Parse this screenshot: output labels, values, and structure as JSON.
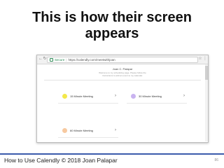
{
  "slide": {
    "title_line1": "This is how their screen",
    "title_line2": "appears",
    "footer": "How to Use Calendly © 2018 Joan Palapar",
    "page_number": "86"
  },
  "browser": {
    "secure_label": "Secure",
    "url": "https://calendly.com/meetwithjoan",
    "back_icon": "←",
    "forward_icon": "→",
    "reload_icon": "↻",
    "star_icon": "☆",
    "menu_icon": "⋮"
  },
  "page": {
    "owner_name": "Joan C. Palapar",
    "intro_line1": "Welcome to my scheduling page. Please follow the",
    "intro_line2": "instructions to add an event to my calendar."
  },
  "events": [
    {
      "label": "15 Minute Meeting",
      "color": "#f3e84a"
    },
    {
      "label": "30 Minute Meeting",
      "color": "#c9b3f0"
    },
    {
      "label": "60 Minute Meeting",
      "color": "#f7c9a0"
    }
  ],
  "chevron": "›"
}
